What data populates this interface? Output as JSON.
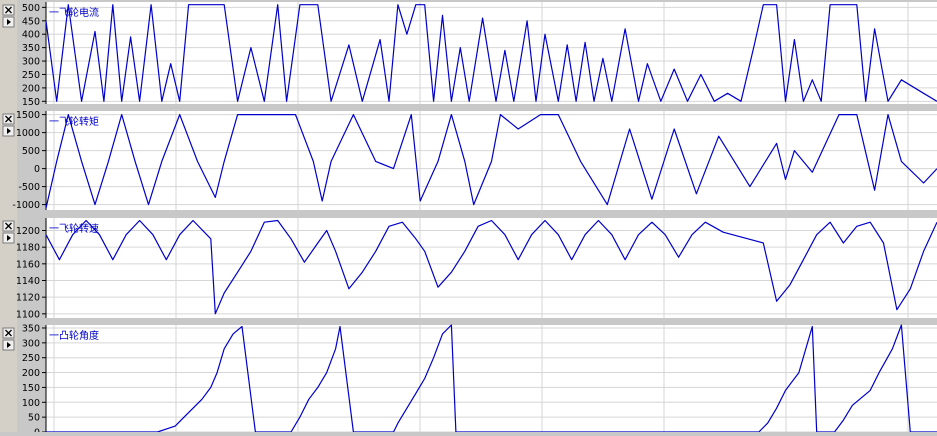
{
  "colors": {
    "trace": "#0000cc",
    "grid": "#d6d6d6",
    "plot_bg": "#ffffff",
    "separator": "#c8c8c8",
    "left_bar": "#d4d0c8",
    "button_face": "#f0f0f0",
    "button_border": "#7a7a7a"
  },
  "icons": [
    "close-icon",
    "expand-arrow-icon"
  ],
  "chart_data": [
    {
      "type": "line",
      "legend": "一飞轮电流",
      "ylim": [
        140,
        520
      ],
      "yticks": [
        150,
        200,
        250,
        300,
        350,
        400,
        450,
        500
      ],
      "grid": true,
      "xlim": [
        0,
        1000
      ],
      "series": [
        {
          "x": [
            0,
            12,
            25,
            40,
            55,
            65,
            75,
            85,
            95,
            105,
            118,
            130,
            140,
            150,
            160,
            172,
            185,
            200,
            215,
            230,
            245,
            260,
            270,
            285,
            295,
            305,
            320,
            340,
            355,
            375,
            385,
            395,
            405,
            415,
            425,
            435,
            445,
            455,
            465,
            475,
            490,
            505,
            515,
            525,
            540,
            550,
            560,
            575,
            585,
            595,
            605,
            615,
            625,
            635,
            650,
            665,
            675,
            690,
            705,
            720,
            735,
            750,
            765,
            780,
            795,
            805,
            815,
            820,
            830,
            840,
            850,
            860,
            870,
            880,
            890,
            900,
            910,
            920,
            930,
            945,
            960,
            985,
            1000
          ],
          "values": [
            450,
            150,
            510,
            150,
            410,
            150,
            510,
            150,
            390,
            150,
            510,
            150,
            290,
            150,
            510,
            510,
            510,
            510,
            150,
            350,
            150,
            510,
            150,
            510,
            510,
            510,
            150,
            360,
            150,
            380,
            150,
            510,
            400,
            510,
            510,
            150,
            470,
            150,
            350,
            150,
            460,
            150,
            340,
            150,
            450,
            150,
            400,
            150,
            360,
            150,
            370,
            150,
            310,
            150,
            420,
            150,
            290,
            150,
            270,
            150,
            250,
            150,
            180,
            150,
            360,
            510,
            510,
            510,
            150,
            380,
            150,
            230,
            150,
            510,
            510,
            510,
            510,
            150,
            420,
            150,
            230,
            180,
            150
          ]
        }
      ]
    },
    {
      "type": "line",
      "legend": "一飞轮转矩",
      "ylim": [
        -1150,
        1600
      ],
      "yticks": [
        -1000,
        -500,
        0,
        500,
        1000,
        1500
      ],
      "grid": true,
      "xlim": [
        0,
        1000
      ],
      "series": [
        {
          "x": [
            0,
            12,
            25,
            40,
            55,
            70,
            85,
            100,
            115,
            130,
            150,
            170,
            190,
            200,
            215,
            230,
            255,
            280,
            300,
            310,
            320,
            345,
            370,
            390,
            410,
            420,
            440,
            455,
            470,
            480,
            500,
            510,
            530,
            555,
            575,
            600,
            630,
            655,
            680,
            705,
            730,
            755,
            790,
            820,
            830,
            840,
            860,
            890,
            910,
            930,
            945,
            960,
            985,
            1000
          ],
          "values": [
            -1100,
            200,
            1500,
            200,
            -1000,
            200,
            1500,
            200,
            -1000,
            200,
            1500,
            200,
            -800,
            200,
            1500,
            1500,
            1500,
            1500,
            200,
            -900,
            200,
            1500,
            200,
            0,
            1500,
            -900,
            200,
            1500,
            200,
            -1000,
            200,
            1500,
            1100,
            1500,
            1500,
            200,
            -1000,
            1100,
            -850,
            1100,
            -700,
            900,
            -500,
            700,
            -300,
            500,
            -100,
            1500,
            1500,
            -600,
            1500,
            200,
            -400,
            0
          ]
        }
      ]
    },
    {
      "type": "line",
      "legend": "一飞轮转速",
      "ylim": [
        1095,
        1215
      ],
      "yticks": [
        1100,
        1120,
        1140,
        1160,
        1180,
        1200
      ],
      "grid": true,
      "xlim": [
        0,
        1000
      ],
      "series": [
        {
          "x": [
            0,
            15,
            30,
            45,
            60,
            75,
            90,
            105,
            120,
            135,
            150,
            165,
            185,
            190,
            200,
            215,
            230,
            245,
            260,
            275,
            290,
            305,
            315,
            325,
            340,
            355,
            370,
            385,
            400,
            415,
            425,
            440,
            455,
            470,
            485,
            500,
            515,
            530,
            545,
            560,
            575,
            590,
            605,
            620,
            635,
            650,
            665,
            680,
            695,
            710,
            725,
            740,
            760,
            805,
            820,
            835,
            850,
            865,
            880,
            895,
            910,
            925,
            940,
            955,
            970,
            985,
            1000
          ],
          "values": [
            1195,
            1165,
            1195,
            1212,
            1195,
            1165,
            1195,
            1212,
            1195,
            1165,
            1195,
            1212,
            1190,
            1100,
            1125,
            1150,
            1175,
            1210,
            1212,
            1190,
            1162,
            1185,
            1200,
            1175,
            1130,
            1150,
            1175,
            1205,
            1210,
            1190,
            1175,
            1132,
            1150,
            1175,
            1205,
            1212,
            1195,
            1165,
            1195,
            1212,
            1195,
            1165,
            1195,
            1212,
            1195,
            1165,
            1195,
            1210,
            1195,
            1168,
            1195,
            1210,
            1198,
            1185,
            1115,
            1135,
            1165,
            1195,
            1210,
            1185,
            1205,
            1210,
            1185,
            1105,
            1130,
            1175,
            1210
          ]
        }
      ]
    },
    {
      "type": "line",
      "legend": "一凸轮角度",
      "ylim": [
        0,
        360
      ],
      "yticks": [
        0,
        50,
        100,
        150,
        200,
        250,
        300,
        350
      ],
      "grid": true,
      "xlim": [
        0,
        1000
      ],
      "series": [
        {
          "x": [
            0,
            125,
            145,
            155,
            165,
            175,
            185,
            192,
            200,
            210,
            220,
            235,
            246,
            265,
            275,
            285,
            295,
            305,
            315,
            325,
            330,
            345,
            360,
            390,
            395,
            405,
            415,
            425,
            435,
            445,
            455,
            460,
            470,
            480,
            490,
            500,
            550,
            600,
            650,
            700,
            750,
            790,
            800,
            810,
            820,
            830,
            845,
            860,
            865,
            875,
            885,
            895,
            905,
            925,
            935,
            950,
            960,
            970,
            975,
            985,
            1000
          ],
          "values": [
            0,
            0,
            20,
            50,
            80,
            110,
            150,
            200,
            280,
            330,
            355,
            0,
            0,
            0,
            0,
            50,
            110,
            150,
            200,
            280,
            355,
            0,
            0,
            0,
            30,
            80,
            130,
            180,
            250,
            330,
            360,
            0,
            0,
            0,
            0,
            0,
            0,
            0,
            0,
            0,
            0,
            0,
            0,
            30,
            80,
            140,
            200,
            355,
            0,
            0,
            0,
            40,
            90,
            140,
            200,
            280,
            360,
            0,
            0,
            0,
            0
          ]
        }
      ]
    }
  ]
}
